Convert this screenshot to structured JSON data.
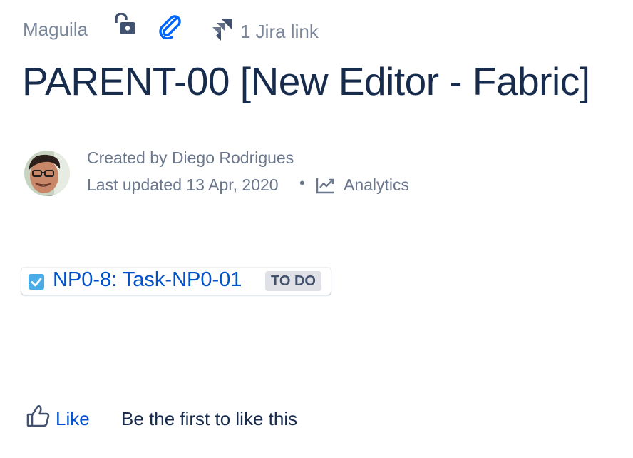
{
  "byline": {
    "space_name": "Maguila",
    "restrictions_icon": "unlocked-padlock-icon",
    "attachments_icon": "paperclip-icon",
    "jira_icon": "jira-icon",
    "jira_link_label": "1 Jira link"
  },
  "page": {
    "title": "PARENT-00 [New Editor - Fabric]"
  },
  "author": {
    "avatar_icon": "user-avatar",
    "created_by": "Created by Diego Rodrigues",
    "last_updated": "Last updated 13 Apr, 2020",
    "separator": "•",
    "analytics_icon": "analytics-chart-icon",
    "analytics_label": "Analytics"
  },
  "content": {
    "smart_link": {
      "icon": "task-checkbox-icon",
      "label": "NP0-8: Task-NP0-01",
      "status": "TO DO"
    }
  },
  "likes": {
    "icon": "thumbs-up-icon",
    "like_label": "Like",
    "summary": "Be the first to like this"
  },
  "colors": {
    "title": "#172b4d",
    "meta": "#6b778c",
    "link": "#0052cc",
    "lozenge_bg": "#dfe1e6",
    "lozenge_text": "#42526e",
    "task_icon": "#4bade8"
  }
}
